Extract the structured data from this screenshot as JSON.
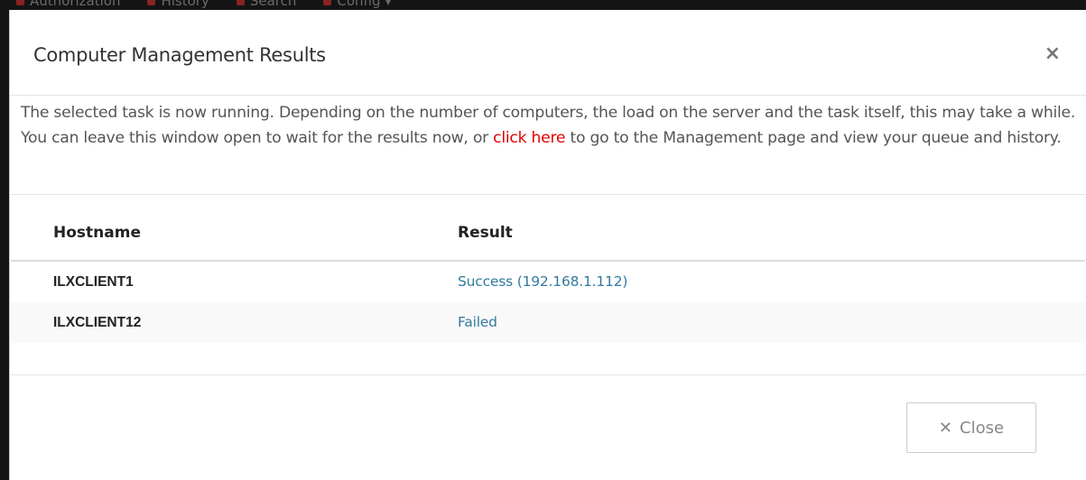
{
  "background_nav": {
    "items": [
      {
        "label": "Authorization"
      },
      {
        "label": "History"
      },
      {
        "label": "Search"
      },
      {
        "label": "Config ▾"
      }
    ]
  },
  "modal": {
    "title": "Computer Management Results",
    "close_icon": "×",
    "intro": {
      "before_link": "The selected task is now running. Depending on the number of computers, the load on the server and the task itself, this may take a while. You can leave this window open to wait for the results now, or ",
      "link": "click here",
      "after_link": " to go to the Management page and view your queue and history."
    },
    "table": {
      "headers": {
        "hostname": "Hostname",
        "result": "Result"
      },
      "rows": [
        {
          "hostname": "ILXCLIENT1",
          "result": "Success (192.168.1.112)"
        },
        {
          "hostname": "ILXCLIENT12",
          "result": "Failed"
        }
      ]
    },
    "footer": {
      "close_glyph": "✕",
      "close_label": "Close"
    }
  },
  "colors": {
    "link_red": "#e00000",
    "result_blue": "#337a9e",
    "backdrop": "#141414"
  }
}
